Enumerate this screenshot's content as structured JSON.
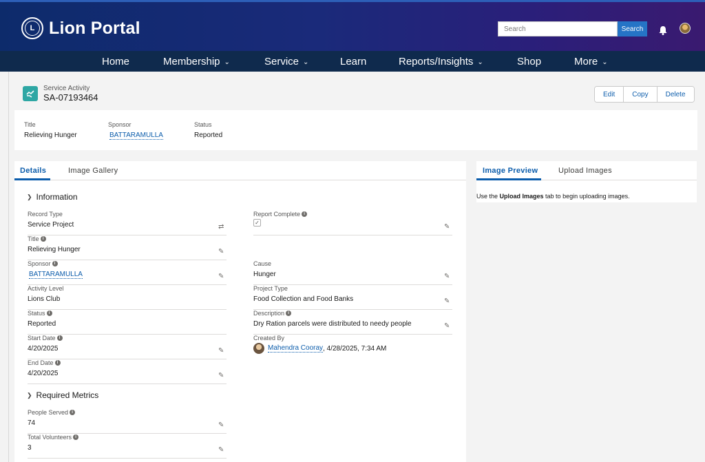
{
  "header": {
    "brand": "Lion Portal",
    "logo_mark": "LIONS",
    "search_placeholder": "Search",
    "search_button": "Search"
  },
  "nav": {
    "items": [
      {
        "label": "Home",
        "has_menu": false
      },
      {
        "label": "Membership",
        "has_menu": true
      },
      {
        "label": "Service",
        "has_menu": true
      },
      {
        "label": "Learn",
        "has_menu": false
      },
      {
        "label": "Reports/Insights",
        "has_menu": true
      },
      {
        "label": "Shop",
        "has_menu": false
      },
      {
        "label": "More",
        "has_menu": true
      }
    ]
  },
  "record": {
    "object_label": "Service Activity",
    "name": "SA-07193464",
    "actions": [
      "Edit",
      "Copy",
      "Delete"
    ]
  },
  "highlights": {
    "title_label": "Title",
    "title_value": "Relieving Hunger",
    "sponsor_label": "Sponsor",
    "sponsor_value": "BATTARAMULLA",
    "status_label": "Status",
    "status_value": "Reported"
  },
  "tabs": {
    "details": "Details",
    "gallery": "Image Gallery"
  },
  "sections": {
    "information": "Information",
    "required_metrics": "Required Metrics"
  },
  "fields": {
    "record_type": {
      "label": "Record Type",
      "value": "Service Project"
    },
    "title": {
      "label": "Title",
      "value": "Relieving Hunger"
    },
    "sponsor": {
      "label": "Sponsor",
      "value": "BATTARAMULLA"
    },
    "activity_level": {
      "label": "Activity Level",
      "value": "Lions Club"
    },
    "status": {
      "label": "Status",
      "value": "Reported"
    },
    "start_date": {
      "label": "Start Date",
      "value": "4/20/2025"
    },
    "end_date": {
      "label": "End Date",
      "value": "4/20/2025"
    },
    "report_complete": {
      "label": "Report Complete",
      "checked": true
    },
    "cause": {
      "label": "Cause",
      "value": "Hunger"
    },
    "project_type": {
      "label": "Project Type",
      "value": "Food Collection and Food Banks"
    },
    "description": {
      "label": "Description",
      "value": "Dry Ration parcels were distributed to needy people"
    },
    "created_by": {
      "label": "Created By",
      "name": "Mahendra Cooray",
      "date": ", 4/28/2025, 7:34 AM"
    },
    "people_served": {
      "label": "People Served",
      "value": "74"
    },
    "total_volunteers": {
      "label": "Total Volunteers",
      "value": "3"
    }
  },
  "right_panel": {
    "tab_preview": "Image Preview",
    "tab_upload": "Upload Images",
    "msg_prefix": "Use the ",
    "msg_bold": "Upload Images",
    "msg_suffix": " tab to begin uploading images."
  },
  "colors": {
    "header_start": "#0d2b6b",
    "nav_bg": "#0f2a4d",
    "link": "#0b5cab",
    "record_icon": "#2ea7a4",
    "search_button": "#2574c6"
  }
}
